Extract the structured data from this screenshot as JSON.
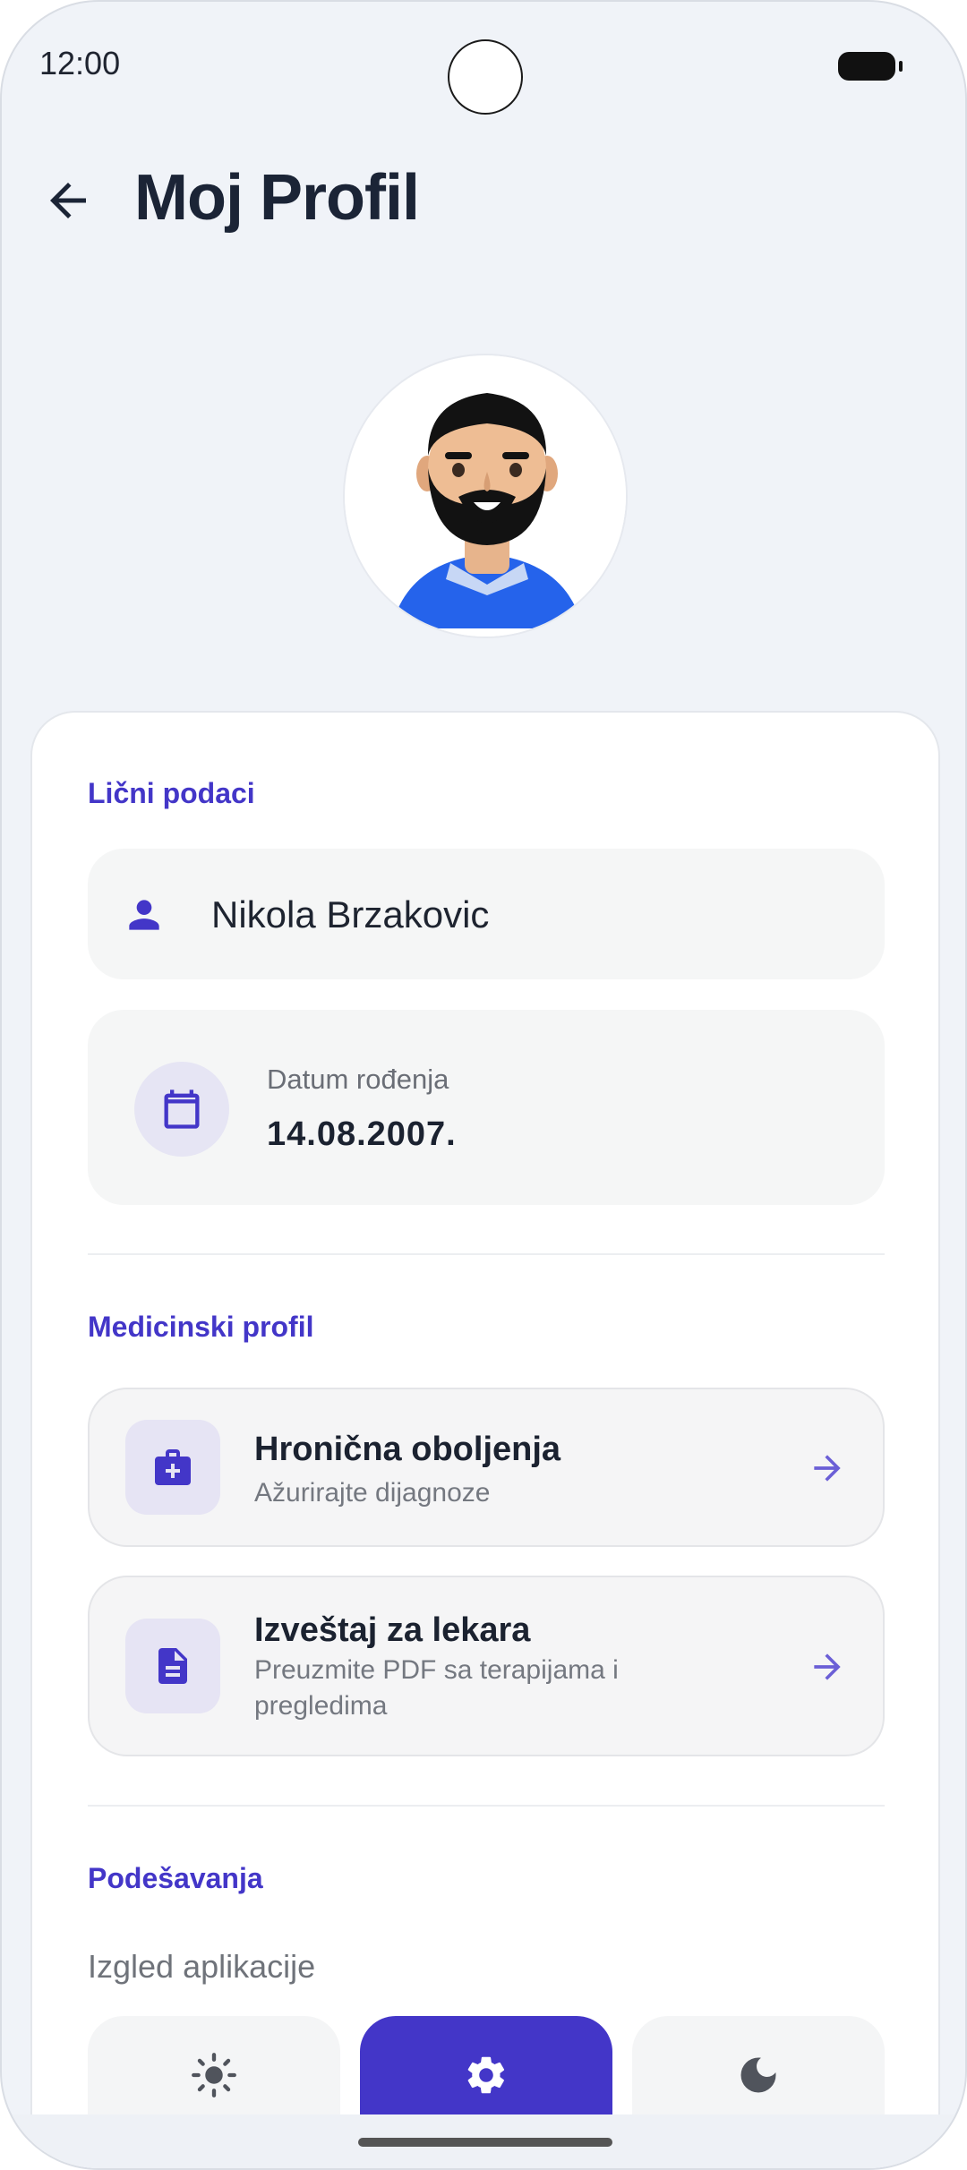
{
  "status_bar": {
    "time": "12:00"
  },
  "header": {
    "title": "Moj Profil"
  },
  "personal": {
    "section_label": "Lični podaci",
    "name": "Nikola Brzakovic",
    "dob_label": "Datum rođenja",
    "dob_value": "14.08.2007."
  },
  "medical": {
    "section_label": "Medicinski profil",
    "items": [
      {
        "title": "Hronična oboljenja",
        "subtitle": "Ažurirajte dijagnoze",
        "icon": "medical-bag-icon"
      },
      {
        "title": "Izveštaj za lekara",
        "subtitle": "Preuzmite PDF sa terapijama i pregledima",
        "icon": "document-icon"
      }
    ]
  },
  "settings": {
    "section_label": "Podešavanja",
    "appearance_label": "Izgled aplikacije",
    "theme_options": [
      {
        "icon": "sun-icon",
        "selected": false
      },
      {
        "icon": "gear-icon",
        "selected": true
      },
      {
        "icon": "moon-icon",
        "selected": false
      }
    ]
  },
  "colors": {
    "accent": "#4336c8",
    "background": "#f0f3f8",
    "card": "#ffffff",
    "avatar_shirt": "#2563eb"
  }
}
